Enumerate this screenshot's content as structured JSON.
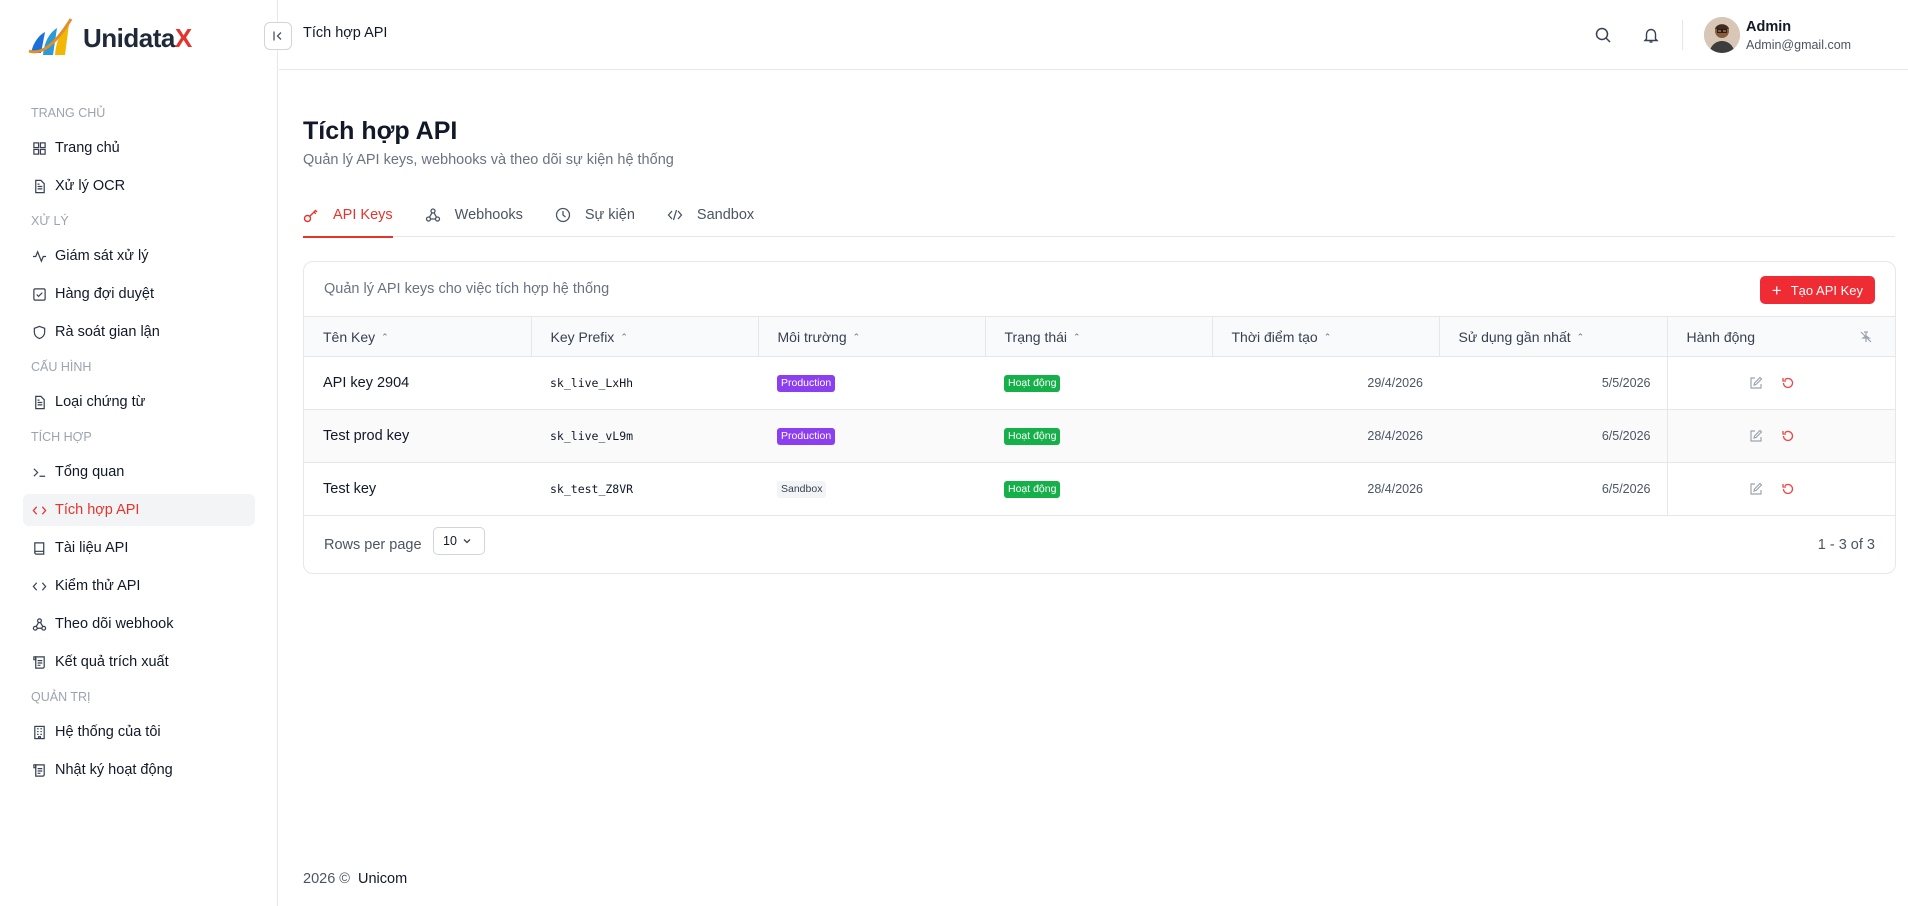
{
  "brand": {
    "name_main": "Unidata",
    "name_accent": "X",
    "accent_color": "#e5342b"
  },
  "sidebar": {
    "sections": [
      {
        "label": "TRANG CHỦ",
        "items": [
          {
            "label": "Trang chủ",
            "icon": "grid-icon"
          },
          {
            "label": "Xử lý OCR",
            "icon": "file-text-icon"
          }
        ]
      },
      {
        "label": "XỬ LÝ",
        "items": [
          {
            "label": "Giám sát xử lý",
            "icon": "activity-icon"
          },
          {
            "label": "Hàng đợi duyệt",
            "icon": "check-square-icon"
          },
          {
            "label": "Rà soát gian lận",
            "icon": "shield-icon"
          }
        ]
      },
      {
        "label": "CẤU HÌNH",
        "items": [
          {
            "label": "Loại chứng từ",
            "icon": "file-text-icon"
          }
        ]
      },
      {
        "label": "TÍCH HỢP",
        "items": [
          {
            "label": "Tổng quan",
            "icon": "terminal-icon"
          },
          {
            "label": "Tích hợp API",
            "icon": "code-icon",
            "active": true
          },
          {
            "label": "Tài liệu API",
            "icon": "book-icon"
          },
          {
            "label": "Kiểm thử API",
            "icon": "code-icon"
          },
          {
            "label": "Theo dõi webhook",
            "icon": "webhook-icon"
          },
          {
            "label": "Kết quả trích xuất",
            "icon": "scroll-icon"
          }
        ]
      },
      {
        "label": "QUẢN TRỊ",
        "items": [
          {
            "label": "Hệ thống của tôi",
            "icon": "building-icon"
          },
          {
            "label": "Nhật ký hoạt động",
            "icon": "scroll-icon"
          }
        ]
      }
    ]
  },
  "header": {
    "title": "Tích hợp API",
    "user": {
      "name": "Admin",
      "email": "Admin@gmail.com"
    }
  },
  "page": {
    "title": "Tích hợp API",
    "subtitle": "Quản lý API keys, webhooks và theo dõi sự kiện hệ thống",
    "tabs": [
      {
        "label": "API Keys",
        "icon": "key-icon",
        "active": true
      },
      {
        "label": "Webhooks",
        "icon": "webhook-icon"
      },
      {
        "label": "Sự kiện",
        "icon": "clock-icon"
      },
      {
        "label": "Sandbox",
        "icon": "code-icon"
      }
    ]
  },
  "card": {
    "description": "Quản lý API keys cho việc tích hợp hệ thống",
    "create_label": "Tạo API Key",
    "columns": [
      "Tên Key",
      "Key Prefix",
      "Môi trường",
      "Trạng thái",
      "Thời điểm tạo",
      "Sử dụng gần nhất",
      "Hành động"
    ],
    "rows": [
      {
        "name": "API key 2904",
        "prefix": "sk_live_LxHh",
        "env": "Production",
        "env_type": "prod",
        "status": "Hoạt động",
        "created": "29/4/2026",
        "last_used": "5/5/2026"
      },
      {
        "name": "Test prod key",
        "prefix": "sk_live_vL9m",
        "env": "Production",
        "env_type": "prod",
        "status": "Hoạt động",
        "created": "28/4/2026",
        "last_used": "6/5/2026"
      },
      {
        "name": "Test key",
        "prefix": "sk_test_Z8VR",
        "env": "Sandbox",
        "env_type": "sand",
        "status": "Hoạt động",
        "created": "28/4/2026",
        "last_used": "6/5/2026"
      }
    ],
    "pagination": {
      "rows_label": "Rows per page",
      "rows_value": "10",
      "range": "1 - 3 of 3"
    }
  },
  "colors": {
    "primary": "#ef2b33",
    "production": "#8b3ff0",
    "active": "#16b04a"
  },
  "footer": {
    "year": "2026 ©",
    "org": "Unicom"
  }
}
